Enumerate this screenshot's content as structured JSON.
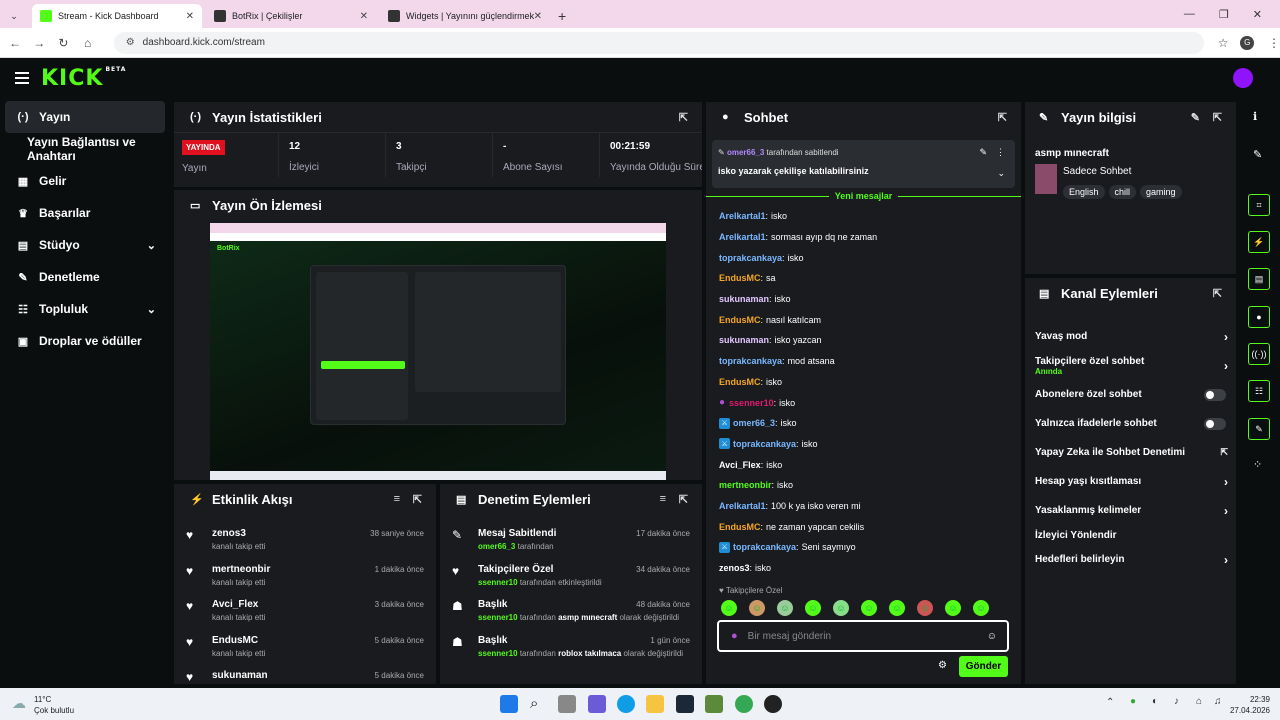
{
  "browser": {
    "tabs": [
      {
        "title": "Stream - Kick Dashboard",
        "active": true,
        "favicon_color": "#53fc18"
      },
      {
        "title": "BotRix | Çekilişler",
        "active": false,
        "favicon_color": "#333333"
      },
      {
        "title": "Widgets | Yayınını güçlendirmek",
        "active": false,
        "favicon_color": "#333333"
      }
    ],
    "url": "dashboard.kick.com/stream",
    "profile_initial": "G"
  },
  "kick": {
    "logo": "KICK",
    "beta": "BETA",
    "accent": "#53fc18"
  },
  "sidebar": {
    "items": [
      {
        "label": "Yayın",
        "icon": "broadcast-icon",
        "glyph": "(·)",
        "active": true
      },
      {
        "label": "Yayın Bağlantısı ve Anahtarı",
        "icon": "",
        "glyph": "",
        "active": false
      },
      {
        "label": "Gelir",
        "icon": "bank-icon",
        "glyph": "▦",
        "active": false
      },
      {
        "label": "Başarılar",
        "icon": "trophy-icon",
        "glyph": "♛",
        "active": false
      },
      {
        "label": "Stüdyo",
        "icon": "grid-icon",
        "glyph": "▤",
        "active": false,
        "chevron": true
      },
      {
        "label": "Denetleme",
        "icon": "wrench-icon",
        "glyph": "✎",
        "active": false
      },
      {
        "label": "Topluluk",
        "icon": "people-icon",
        "glyph": "☷",
        "active": false,
        "chevron": true
      },
      {
        "label": "Droplar ve ödüller",
        "icon": "gift-icon",
        "glyph": "▣",
        "active": false
      }
    ]
  },
  "stats": {
    "title": "Yayın İstatistikleri",
    "live_badge": "YAYINDA",
    "live_label": "Yayın",
    "viewers": {
      "value": "12",
      "label": "İzleyici"
    },
    "followers": {
      "value": "3",
      "label": "Takipçi"
    },
    "subs": {
      "value": "-",
      "label": "Abone Sayısı"
    },
    "duration": {
      "value": "00:21:59",
      "label": "Yayında Olduğu Süre"
    }
  },
  "preview": {
    "title": "Yayın Ön İzlemesi",
    "brand": "BotRix"
  },
  "activity": {
    "title": "Etkinlik Akışı",
    "rows": [
      {
        "user": "zenos3",
        "action": "kanalı takip etti",
        "time": "38 saniye önce"
      },
      {
        "user": "mertneonbir",
        "action": "kanalı takip etti",
        "time": "1 dakika önce"
      },
      {
        "user": "Avci_Flex",
        "action": "kanalı takip etti",
        "time": "3 dakika önce"
      },
      {
        "user": "EndusMC",
        "action": "kanalı takip etti",
        "time": "5 dakika önce"
      },
      {
        "user": "sukunaman",
        "action": "",
        "time": "5 dakika önce"
      }
    ]
  },
  "mod": {
    "title": "Denetim Eylemleri",
    "rows": [
      {
        "title": "Mesaj Sabitlendi",
        "user": "omer66_3",
        "mid": "tarafından",
        "value": "",
        "tail": "",
        "time": "17 dakika önce",
        "icon": "pin-icon",
        "glyph": "✎"
      },
      {
        "title": "Takipçilere Özel",
        "user": "ssenner10",
        "mid": "tarafından etkinleştirildi",
        "value": "",
        "tail": "",
        "time": "34 dakika önce",
        "icon": "heart-icon",
        "glyph": "♥"
      },
      {
        "title": "Başlık",
        "user": "ssenner10",
        "mid": "tarafından",
        "value": "asmp mınecraft",
        "tail": "olarak değiştirildi",
        "time": "48 dakika önce",
        "icon": "user-edit-icon",
        "glyph": "☗"
      },
      {
        "title": "Başlık",
        "user": "ssenner10",
        "mid": "tarafından",
        "value": "roblox takılmaca",
        "tail": "olarak değiştirildi",
        "time": "1 gün önce",
        "icon": "user-edit-icon",
        "glyph": "☗"
      }
    ]
  },
  "chat": {
    "title": "Sohbet",
    "pinned_by": "omer66_3",
    "pinned_by_suffix": "tarafından sabitlendi",
    "pinned_text": "isko yazarak çekilişe katılabilirsiniz",
    "new_messages": "Yeni mesajlar",
    "messages": [
      {
        "user": "Arelkartal1",
        "color": "#7ab8ff",
        "text": "isko",
        "badge": ""
      },
      {
        "user": "Arelkartal1",
        "color": "#7ab8ff",
        "text": "sorması ayıp dq ne zaman",
        "badge": ""
      },
      {
        "user": "toprakcankaya",
        "color": "#7ab8ff",
        "text": "isko",
        "badge": ""
      },
      {
        "user": "EndusMC",
        "color": "#f5a623",
        "text": "sa",
        "badge": ""
      },
      {
        "user": "sukunaman",
        "color": "#e3c6ff",
        "text": "isko",
        "badge": ""
      },
      {
        "user": "EndusMC",
        "color": "#f5a623",
        "text": "nasıl katılcam",
        "badge": ""
      },
      {
        "user": "sukunaman",
        "color": "#e3c6ff",
        "text": "isko yazcan",
        "badge": ""
      },
      {
        "user": "toprakcankaya",
        "color": "#7ab8ff",
        "text": "mod atsana",
        "badge": ""
      },
      {
        "user": "EndusMC",
        "color": "#f5a623",
        "text": "isko",
        "badge": ""
      },
      {
        "user": "ssenner10",
        "color": "#e01a6f",
        "text": "isko",
        "badge": "mic"
      },
      {
        "user": "omer66_3",
        "color": "#7ab8ff",
        "text": "isko",
        "badge": "mod"
      },
      {
        "user": "toprakcankaya",
        "color": "#7ab8ff",
        "text": "isko",
        "badge": "mod"
      },
      {
        "user": "Avci_Flex",
        "color": "#ffffff",
        "text": "isko",
        "badge": ""
      },
      {
        "user": "mertneonbir",
        "color": "#53fc18",
        "text": "isko",
        "badge": ""
      },
      {
        "user": "Arelkartal1",
        "color": "#7ab8ff",
        "text": "100 k ya isko veren mi",
        "badge": ""
      },
      {
        "user": "EndusMC",
        "color": "#f5a623",
        "text": "ne zaman yapcan cekilis",
        "badge": ""
      },
      {
        "user": "toprakcankaya",
        "color": "#7ab8ff",
        "text": "Seni saymıyo",
        "badge": "mod"
      },
      {
        "user": "zenos3",
        "color": "#ffffff",
        "text": "isko",
        "badge": ""
      }
    ],
    "followers_only": "Takipçilere Özel",
    "input_placeholder": "Bir mesaj gönderin",
    "send": "Gönder"
  },
  "stream_info": {
    "title": "Yayın bilgisi",
    "stream_title": "asmp mınecraft",
    "category": "Sadece Sohbet",
    "tags": [
      "English",
      "chill",
      "gaming"
    ]
  },
  "channel_actions": {
    "title": "Kanal Eylemleri",
    "rows": [
      {
        "label": "Yavaş mod",
        "sub": "",
        "control": "chevron"
      },
      {
        "label": "Takipçilere özel sohbet",
        "sub": "Anında",
        "control": "chevron"
      },
      {
        "label": "Abonelere özel sohbet",
        "sub": "",
        "control": "toggle"
      },
      {
        "label": "Yalnızca ifadelerle sohbet",
        "sub": "",
        "control": "toggle"
      },
      {
        "label": "Yapay Zeka ile Sohbet Denetimi",
        "sub": "",
        "control": "external"
      },
      {
        "label": "Hesap yaşı kısıtlaması",
        "sub": "",
        "control": "chevron"
      },
      {
        "label": "Yasaklanmış kelimeler",
        "sub": "",
        "control": "chevron"
      },
      {
        "label": "İzleyici Yönlendir",
        "sub": "",
        "control": "none"
      },
      {
        "label": "Hedefleri belirleyin",
        "sub": "",
        "control": "chevron"
      }
    ]
  },
  "taskbar": {
    "weather_temp": "11°C",
    "weather_desc": "Çok bulutlu",
    "time": "22:39",
    "date": "27.04.2026"
  }
}
